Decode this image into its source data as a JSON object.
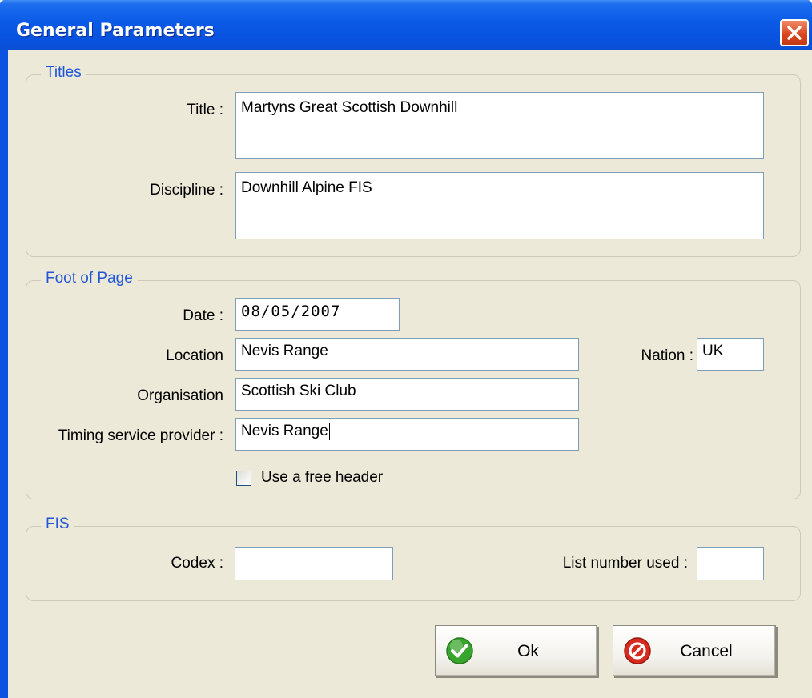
{
  "window": {
    "title": "General Parameters"
  },
  "titles_group": {
    "legend": "Titles",
    "title_label": "Title :",
    "title_value": "Martyns Great Scottish Downhill",
    "discipline_label": "Discipline :",
    "discipline_value": "Downhill Alpine FIS"
  },
  "foot_group": {
    "legend": "Foot of Page",
    "date_label": "Date :",
    "date_value": "08/05/2007",
    "location_label": "Location",
    "location_value": "Nevis Range",
    "nation_label": "Nation :",
    "nation_value": "UK",
    "organisation_label": "Organisation",
    "organisation_value": "Scottish Ski Club",
    "timing_label": "Timing service provider :",
    "timing_value": "Nevis Range",
    "free_header_label": "Use a free header",
    "free_header_checked": false
  },
  "fis_group": {
    "legend": "FIS",
    "codex_label": "Codex :",
    "codex_value": "",
    "list_number_label": "List number used :",
    "list_number_value": ""
  },
  "buttons": {
    "ok_label": "Ok",
    "cancel_label": "Cancel"
  },
  "colors": {
    "titlebar": "#0a5ae6",
    "legend_text": "#1f55d8",
    "client_bg": "#ece9d8",
    "ok_icon": "#3aa52e",
    "cancel_icon": "#d62b1e"
  },
  "icons": {
    "close": "close-icon",
    "ok": "check-icon",
    "cancel": "no-entry-icon"
  }
}
